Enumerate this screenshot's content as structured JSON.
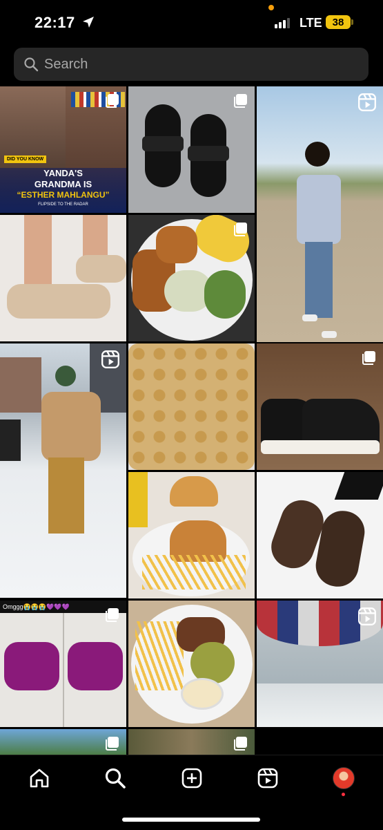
{
  "status_bar": {
    "time": "22:17",
    "network": "LTE",
    "battery": "38"
  },
  "search": {
    "placeholder": "Search"
  },
  "grid": {
    "post1": {
      "tag": "DID YOU KNOW",
      "headline_line1": "YANDA'S",
      "headline_line2": "GRANDMA IS",
      "headline_line3": "“ESTHER MAHLANGU”",
      "footer": "FLIPSIDE TO THE RADAR"
    },
    "post13": {
      "caption": "Omggg😭😭😭💜💜💜"
    }
  },
  "icons": {
    "multi": "multiple-photos-icon",
    "reel": "reels-icon"
  },
  "nav": {
    "items": [
      "home",
      "search",
      "create",
      "reels",
      "profile"
    ]
  },
  "colors": {
    "background": "#000000",
    "search_bg": "#262626",
    "battery": "#f1c40f",
    "notification": "#ff3040"
  }
}
